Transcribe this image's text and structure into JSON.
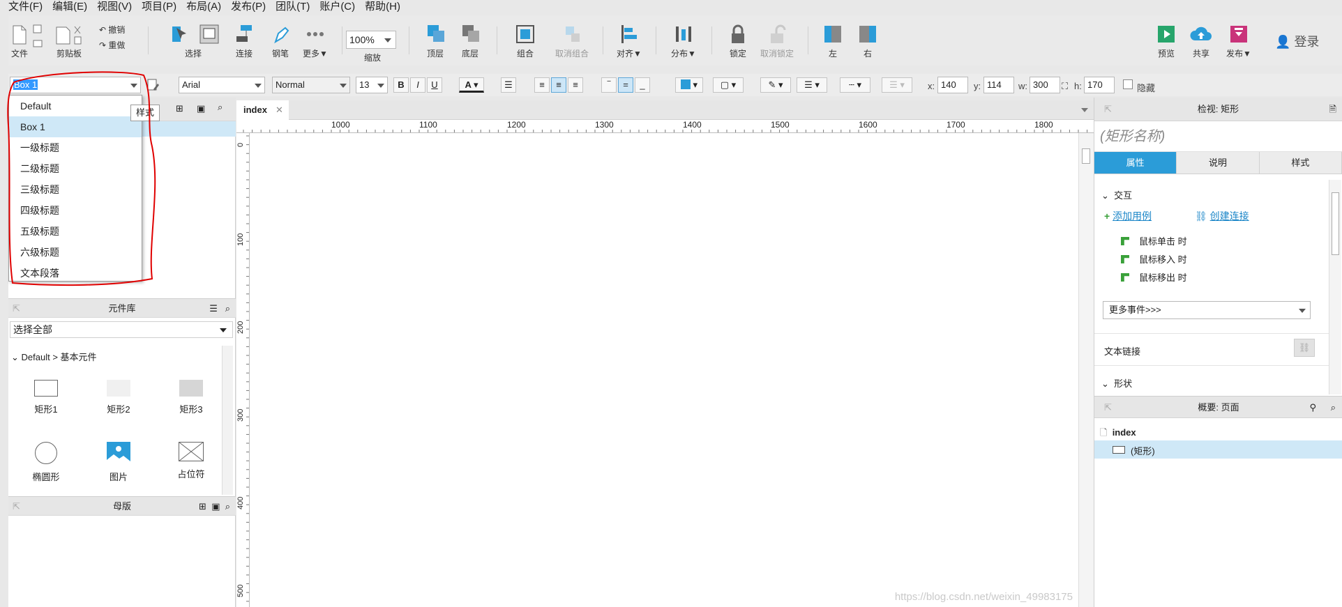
{
  "menu": [
    "文件(F)",
    "编辑(E)",
    "视图(V)",
    "项目(P)",
    "布局(A)",
    "发布(P)",
    "团队(T)",
    "账户(C)",
    "帮助(H)"
  ],
  "toolbar": {
    "file": "文件",
    "clipboard": "剪贴板",
    "undo": "撤销",
    "redo": "重做",
    "select": "选择",
    "connect": "连接",
    "pen": "钢笔",
    "more": "更多▼",
    "zoom_value": "100%",
    "zoom": "缩放",
    "top": "顶层",
    "bottom": "底层",
    "group": "组合",
    "ungroup": "取消组合",
    "align": "对齐▼",
    "distribute": "分布▼",
    "lock": "锁定",
    "unlock": "取消锁定",
    "left": "左",
    "right": "右",
    "preview": "预览",
    "share": "共享",
    "publish": "发布▼",
    "login": "登录"
  },
  "format": {
    "style_value": "Box 1",
    "font": "Arial",
    "weight": "Normal",
    "size": "13",
    "bold": "B",
    "italic": "I",
    "underline": "U",
    "font_color": "A",
    "x_label": "x:",
    "x_value": "140",
    "y_label": "y:",
    "y_value": "114",
    "w_label": "w:",
    "w_value": "300",
    "h_label": "h:",
    "h_value": "170",
    "hidden": "隐藏"
  },
  "style_dropdown": {
    "tooltip": "样式",
    "items": [
      "Default",
      "Box 1",
      "一级标题",
      "二级标题",
      "三级标题",
      "四级标题",
      "五级标题",
      "六级标题",
      "文本段落"
    ],
    "selected": "Box 1"
  },
  "library": {
    "title": "元件库",
    "select_all": "选择全部",
    "category": "Default > 基本元件",
    "widgets": [
      "矩形1",
      "矩形2",
      "矩形3",
      "椭圆形",
      "图片",
      "占位符"
    ]
  },
  "masters": {
    "title": "母版"
  },
  "canvas": {
    "tab": "index",
    "ruler_h": [
      "1000",
      "1100",
      "1200",
      "1300",
      "1400",
      "1500",
      "1600",
      "1700",
      "1800"
    ],
    "ruler_v": [
      "0",
      "100",
      "200",
      "300",
      "400",
      "500"
    ],
    "watermark": "https://blog.csdn.net/weixin_49983175"
  },
  "inspector": {
    "title": "检视: 矩形",
    "name_placeholder": "(矩形名称)",
    "tabs": [
      "属性",
      "说明",
      "样式"
    ],
    "interaction": "交互",
    "add_case": "添加用例",
    "create_link": "创建连接",
    "events": [
      "鼠标单击 时",
      "鼠标移入 时",
      "鼠标移出 时"
    ],
    "more_events": "更多事件>>>",
    "text_link": "文本链接",
    "shape": "形状"
  },
  "outline": {
    "title": "概要: 页面",
    "page": "index",
    "item": "(矩形)"
  },
  "colors": {
    "accent": "#2b9cd8",
    "selected_row": "#cfe8f7",
    "annotation": "#e00000"
  }
}
